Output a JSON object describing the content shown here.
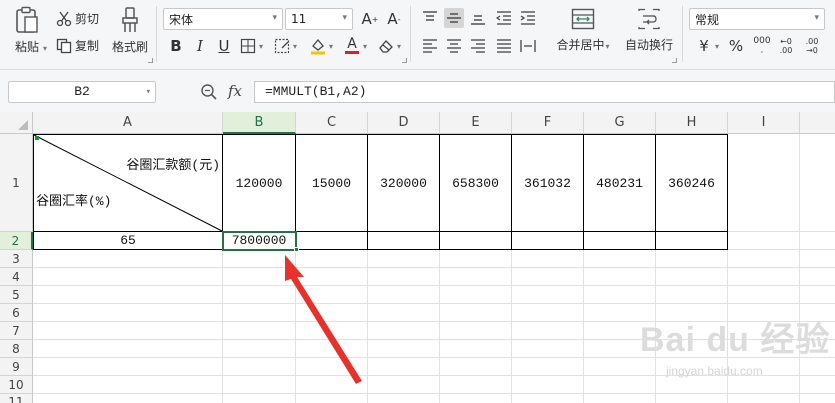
{
  "ribbon": {
    "paste_label": "粘贴",
    "cut_label": "剪切",
    "copy_label": "复制",
    "format_painter_label": "格式刷",
    "font_name": "宋体",
    "font_size": "11",
    "merge_center_label": "合并居中",
    "wrap_text_label": "自动换行",
    "number_format": "常规",
    "currency_symbol": "¥",
    "percent_symbol": "%"
  },
  "formula_bar": {
    "name_box": "B2",
    "fx_label": "fx",
    "formula": "=MMULT(B1,A2)"
  },
  "columns": [
    "A",
    "B",
    "C",
    "D",
    "E",
    "F",
    "G",
    "H",
    "I"
  ],
  "selected_column": "B",
  "rows": [
    "1",
    "2",
    "3",
    "4",
    "5",
    "6",
    "7",
    "8",
    "9",
    "10",
    "11"
  ],
  "selected_row": "2",
  "cells": {
    "A1_header_right": "谷圈汇款额(元)",
    "A1_header_left": "谷圈汇率(%)",
    "B1": "120000",
    "C1": "15000",
    "D1": "320000",
    "E1": "658300",
    "F1": "361032",
    "G1": "480231",
    "H1": "360246",
    "A2": "65",
    "B2": "7800000"
  },
  "annotation": {
    "arrow_color": "#e8312a"
  },
  "accent_color": "#217346",
  "watermark": {
    "brand": "Bai du 经验",
    "url": "jingyan.baidu.com"
  }
}
